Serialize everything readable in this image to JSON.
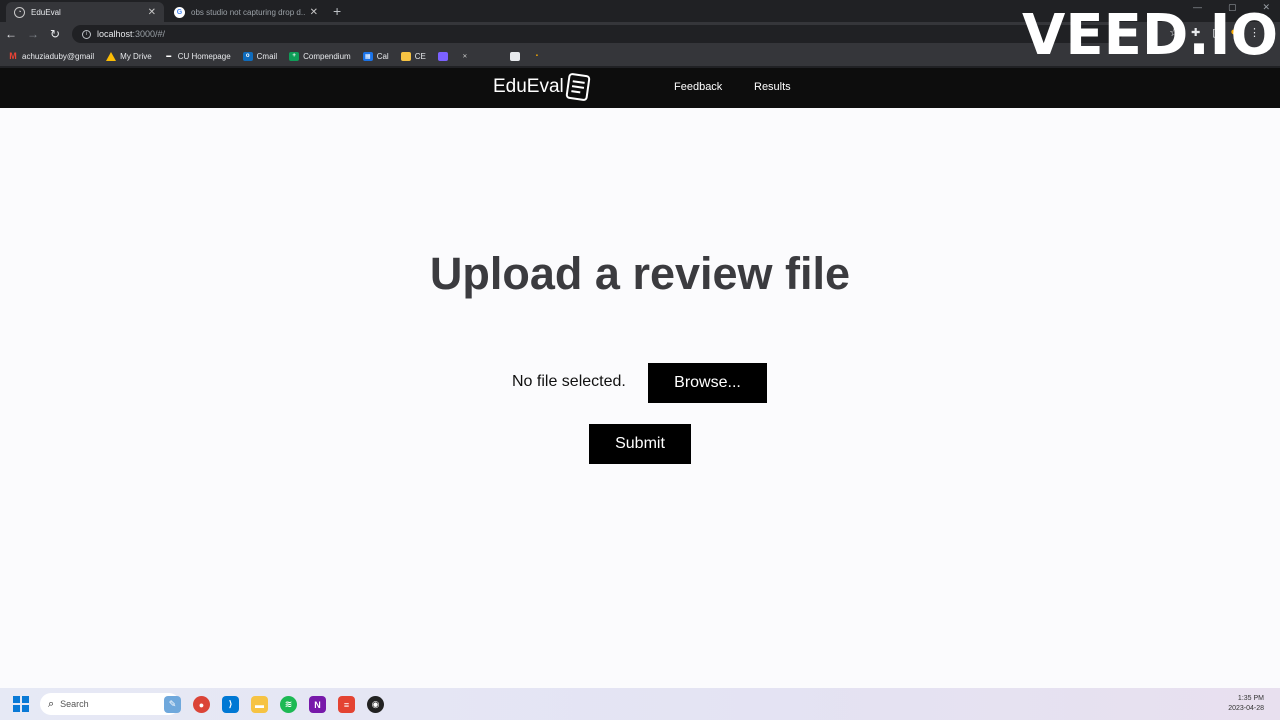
{
  "browser": {
    "tabs": [
      {
        "title": "EduEval",
        "active": true
      },
      {
        "title": "obs studio not capturing drop d...",
        "active": false
      }
    ],
    "url": {
      "host": "localhost",
      "path": ":3000/#/"
    },
    "bookmarks": [
      "achuziaduby@gmail",
      "My Drive",
      "CU Homepage",
      "Cmail",
      "Compendium",
      "Cal",
      "CE"
    ]
  },
  "watermark": "VEED.IO",
  "app": {
    "brand": "EduEval",
    "nav": {
      "feedback": "Feedback",
      "results": "Results"
    },
    "upload": {
      "heading": "Upload a review file",
      "file_status": "No file selected.",
      "browse_label": "Browse...",
      "submit_label": "Submit"
    }
  },
  "taskbar": {
    "search_placeholder": "Search",
    "time": "1:35 PM",
    "date": "2023-04-28"
  },
  "colors": {
    "nav_bg": "#0d0d0d",
    "page_bg": "#fbfbfd",
    "button_bg": "#000000",
    "heading": "#3b3b3f"
  }
}
